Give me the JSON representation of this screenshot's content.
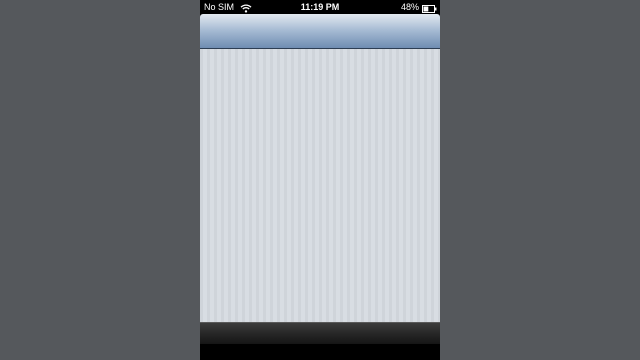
{
  "status_bar": {
    "carrier": "No SIM",
    "time": "11:19 PM",
    "battery_percent": "48%",
    "battery_level": 0.48,
    "wifi_icon": "wifi-icon",
    "battery_icon": "battery-icon"
  },
  "colors": {
    "backdrop": "#55585c",
    "nav_bar_top": "#e3e9f0",
    "nav_bar_bottom": "#6f8db2",
    "content_background": "#d3d8de",
    "toolbar": "#262626"
  }
}
